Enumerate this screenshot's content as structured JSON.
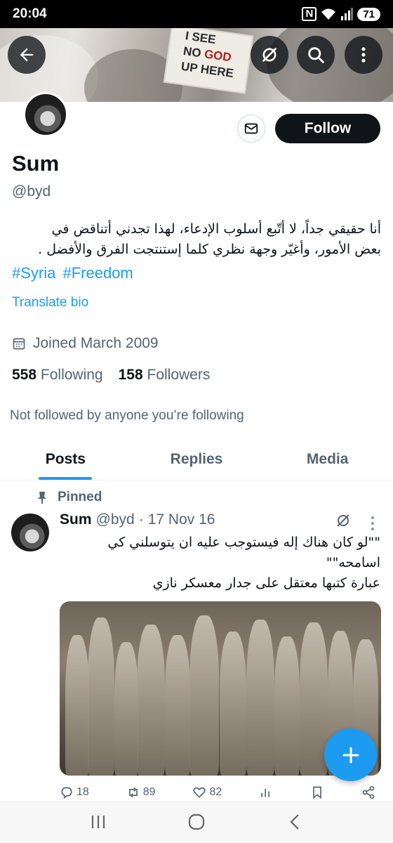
{
  "status_bar": {
    "time": "20:04",
    "nfc": "N",
    "battery": "71"
  },
  "banner": {
    "sign_line1": "I SEE",
    "sign_line2_a": "NO ",
    "sign_line2_b": "GOD",
    "sign_line3": "UP HERE"
  },
  "top_actions": {
    "icons": [
      "back-arrow-icon",
      "grok-icon",
      "search-icon",
      "more-vertical-icon"
    ]
  },
  "profile": {
    "follow_label": "Follow",
    "message_icon": "envelope-icon",
    "display_name": "Sum",
    "handle": "@byd",
    "bio_line1": "أنا حقيقي جداً، لا أتّبع أسلوب الإدعاء، لهذا تجدني أتناقض في",
    "bio_line2": "بعض الأمور، وأغيّر وجهة نظري كلما إستنتجت الفرق والأفضل .",
    "hashtag1": "#Syria",
    "hashtag2": "#Freedom",
    "translate_bio": "Translate bio",
    "joined": "Joined March 2009",
    "following_count": "558",
    "following_label": "Following",
    "followers_count": "158",
    "followers_label": "Followers",
    "not_followed": "Not followed by anyone you’re following"
  },
  "tabs": [
    {
      "label": "Posts",
      "active": true
    },
    {
      "label": "Replies",
      "active": false
    },
    {
      "label": "Media",
      "active": false
    }
  ],
  "post": {
    "pinned_label": "Pinned",
    "name": "Sum",
    "handle": "@byd",
    "separator": "·",
    "date": "17 Nov 16",
    "text_line1": "\"\"لو كان هناك إله فيستوجب عليه ان يتوسلني كي",
    "text_line2": "اسامحه\"\"",
    "text_line3": "عبارة كتبها معتقل على جدار معسكر نازي",
    "replies": "18",
    "reposts": "89",
    "likes": "82"
  },
  "colors": {
    "accent": "#1d9bf0",
    "text": "#0f1419",
    "secondary": "#536471"
  },
  "nav_bar": {
    "icons": [
      "recent-apps-icon",
      "home-circle-icon",
      "back-chevron-icon"
    ]
  }
}
